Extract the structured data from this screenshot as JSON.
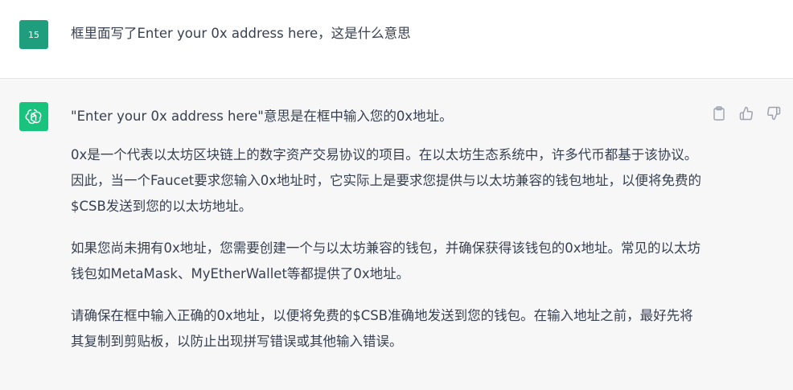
{
  "user_message": {
    "avatar_label": "15",
    "text": "框里面写了Enter your 0x address here，这是什么意思"
  },
  "assistant_message": {
    "icon": "openai-logo-icon",
    "paragraphs": [
      "\"Enter your 0x address here\"意思是在框中输入您的0x地址。",
      "0x是一个代表以太坊区块链上的数字资产交易协议的项目。在以太坊生态系统中，许多代币都基于该协议。因此，当一个Faucet要求您输入0x地址时，它实际上是要求您提供与以太坊兼容的钱包地址，以便将免费的$CSB发送到您的以太坊地址。",
      "如果您尚未拥有0x地址，您需要创建一个与以太坊兼容的钱包，并确保获得该钱包的0x地址。常见的以太坊钱包如MetaMask、MyEtherWallet等都提供了0x地址。",
      "请确保在框中输入正确的0x地址，以便将免费的$CSB准确地发送到您的钱包。在输入地址之前，最好先将其复制到剪贴板，以防止出现拼写错误或其他输入错误。"
    ]
  },
  "actions": {
    "copy_icon": "clipboard-icon",
    "like_icon": "thumbs-up-icon",
    "dislike_icon": "thumbs-down-icon"
  },
  "colors": {
    "user_avatar": "#1f9e7e",
    "bot_avatar": "#19c37d",
    "assistant_bg": "#f7f7f8",
    "text": "#374151"
  }
}
